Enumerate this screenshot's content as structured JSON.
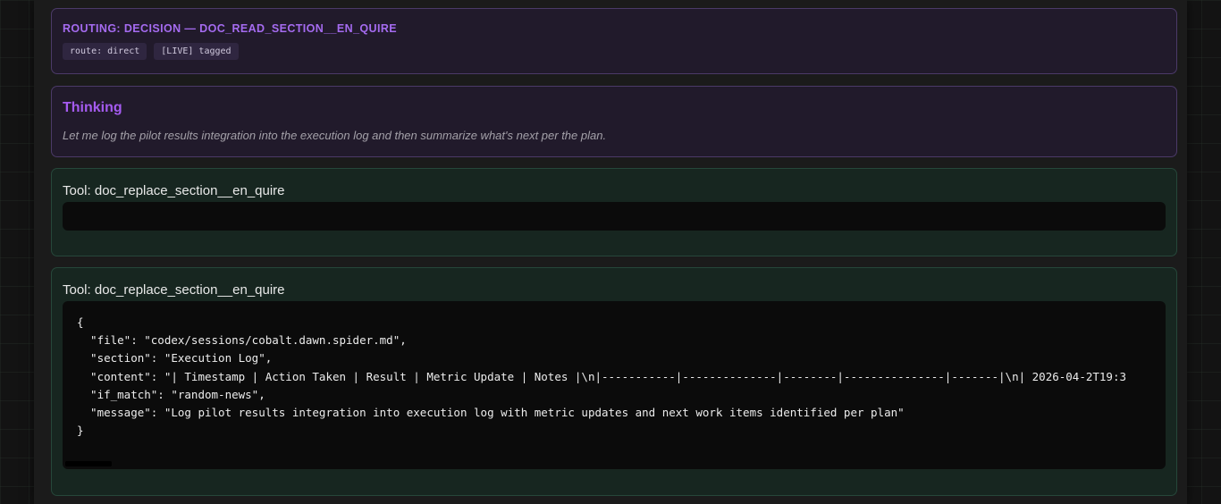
{
  "routing": {
    "title": "ROUTING: DECISION — DOC_READ_SECTION__EN_QUIRE",
    "chips": [
      "route: direct",
      "[LIVE] tagged"
    ]
  },
  "thinking": {
    "title": "Thinking",
    "text": "Let me log the pilot results integration into the execution log and then summarize what's next per the plan."
  },
  "tools": [
    {
      "title": "Tool: doc_replace_section__en_quire",
      "code": ""
    },
    {
      "title": "Tool: doc_replace_section__en_quire",
      "code_lines": [
        "{",
        "  \"file\": \"codex/sessions/cobalt.dawn.spider.md\",",
        "  \"section\": \"Execution Log\",",
        "  \"content\": \"| Timestamp | Action Taken | Result | Metric Update | Notes |\\n|-----------|--------------|--------|---------------|-------|\\n| 2026-04-2T19:3",
        "  \"if_match\": \"random-news\",",
        "  \"message\": \"Log pilot results integration into execution log with metric updates and next work items identified per plan\"",
        "}"
      ]
    }
  ]
}
